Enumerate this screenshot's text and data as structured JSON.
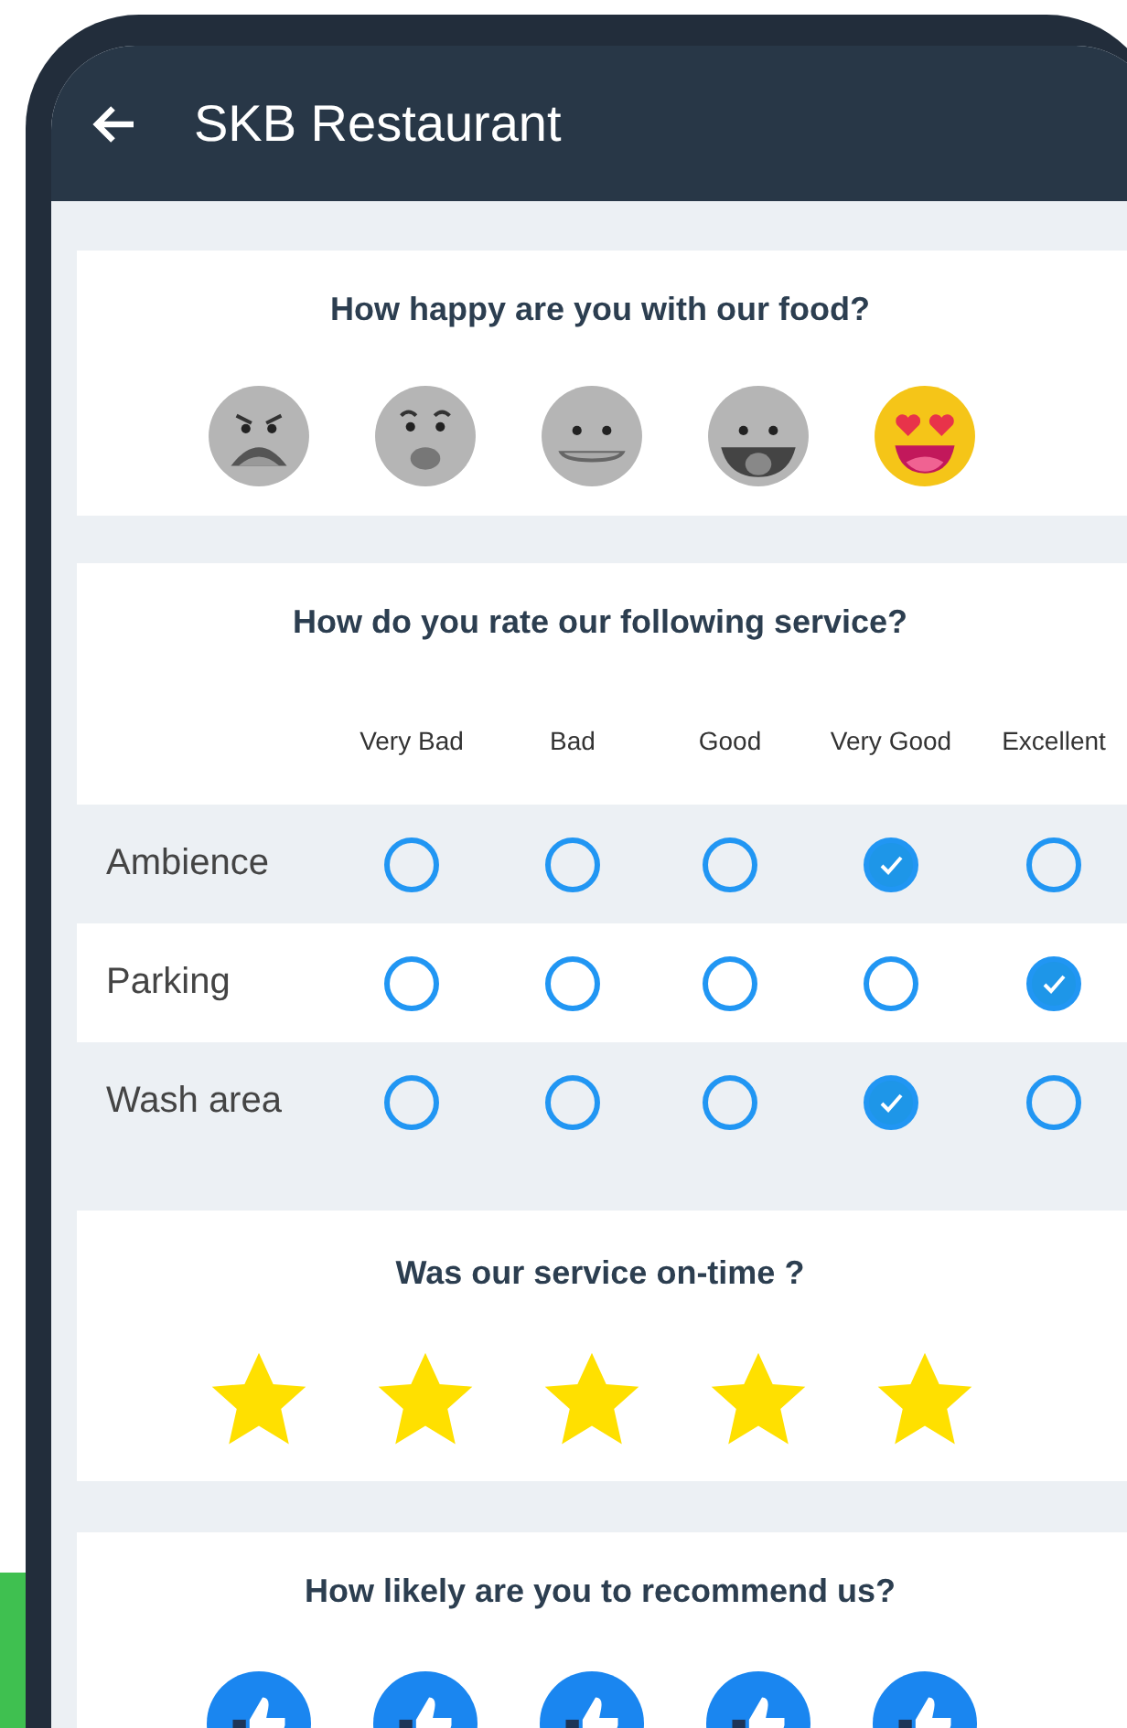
{
  "app_bar": {
    "title": "SKB Restaurant"
  },
  "food": {
    "question": "How happy are you with our food?",
    "faces": [
      {
        "kind": "angry",
        "selected": false
      },
      {
        "kind": "surprised",
        "selected": false
      },
      {
        "kind": "neutral",
        "selected": false
      },
      {
        "kind": "grin",
        "selected": false
      },
      {
        "kind": "love",
        "selected": true
      }
    ]
  },
  "service": {
    "question": "How do you rate our following service?",
    "columns": [
      "Very Bad",
      "Bad",
      "Good",
      "Very Good",
      "Excellent"
    ],
    "rows": [
      {
        "label": "Ambience",
        "options": [
          {
            "selected": false
          },
          {
            "selected": false
          },
          {
            "selected": false
          },
          {
            "selected": true
          },
          {
            "selected": false
          }
        ]
      },
      {
        "label": "Parking",
        "options": [
          {
            "selected": false
          },
          {
            "selected": false
          },
          {
            "selected": false
          },
          {
            "selected": false
          },
          {
            "selected": true
          }
        ]
      },
      {
        "label": "Wash area",
        "options": [
          {
            "selected": false
          },
          {
            "selected": false
          },
          {
            "selected": false
          },
          {
            "selected": true
          },
          {
            "selected": false
          }
        ]
      }
    ]
  },
  "on_time": {
    "question": "Was our service on-time ?",
    "stars": 5
  },
  "recommend": {
    "question": "How likely are you to recommend us?"
  }
}
